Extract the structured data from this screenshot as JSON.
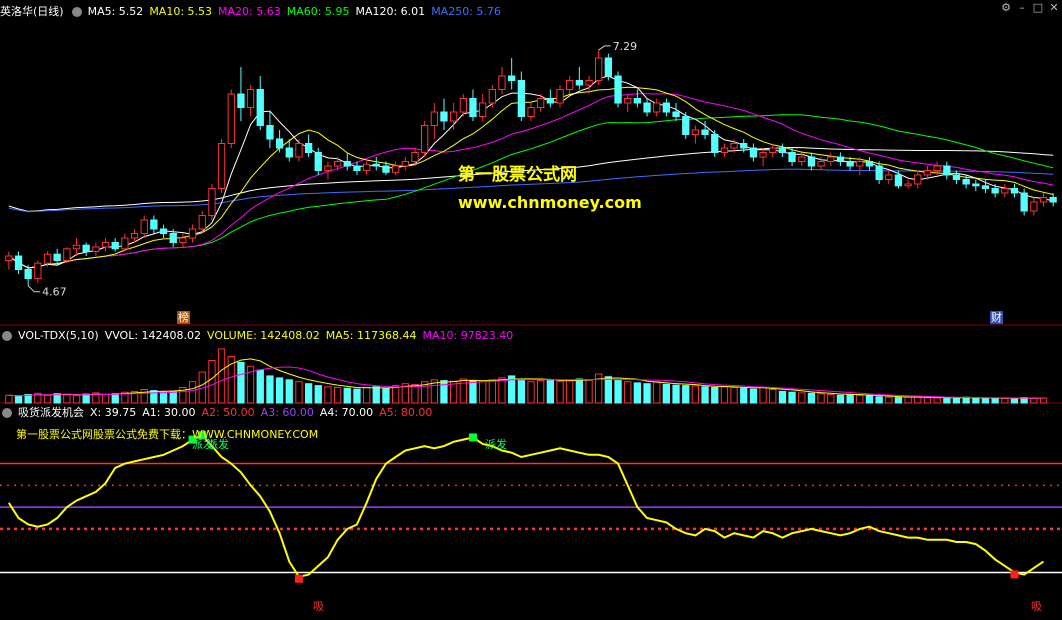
{
  "header": {
    "stock_name": "英洛华(日线)",
    "ma_items": [
      {
        "label": "MA5: 5.52",
        "color": "#ffffff"
      },
      {
        "label": "MA10: 5.53",
        "color": "#ffff00"
      },
      {
        "label": "MA20: 5.63",
        "color": "#ff00ff"
      },
      {
        "label": "MA60: 5.95",
        "color": "#00ff00"
      },
      {
        "label": "MA120: 6.01",
        "color": "#ffffff"
      },
      {
        "label": "MA250: 5.76",
        "color": "#3f6cff"
      }
    ]
  },
  "volume_header": {
    "name": "VOL-TDX(5,10)",
    "items": [
      {
        "label": "VVOL: 142408.02",
        "color": "#ffffff"
      },
      {
        "label": "VOLUME: 142408.02",
        "color": "#ffff00"
      },
      {
        "label": "MA5: 117368.44",
        "color": "#ffff00"
      },
      {
        "label": "MA10: 97823.40",
        "color": "#ff00ff"
      }
    ]
  },
  "indicator_header": {
    "name": "吸货派发机会",
    "items": [
      {
        "label": "X: 39.75",
        "color": "#ffffff"
      },
      {
        "label": "A1: 30.00",
        "color": "#ffffff"
      },
      {
        "label": "A2: 50.00",
        "color": "#ff3030"
      },
      {
        "label": "A3: 60.00",
        "color": "#9a40ff"
      },
      {
        "label": "A4: 70.00",
        "color": "#ffffff"
      },
      {
        "label": "A5: 80.00",
        "color": "#ff3030"
      }
    ]
  },
  "watermark": {
    "title": "第一股票公式网",
    "url": "www.chnmoney.com",
    "indicator_text": "第一股票公式网股票公式免费下载：WWW.CHNMONEY.COM"
  },
  "markers": {
    "bang": "榜",
    "cai": "财",
    "paifa": "派发",
    "xi": "吸"
  },
  "icons": [
    "circle-icon",
    "gear-icon",
    "minus-icon",
    "expand-icon",
    "close-icon"
  ],
  "chart_data": [
    {
      "type": "candlestick",
      "title": "英洛华(日线)",
      "price_labels": {
        "high": "7.29",
        "low": "4.67"
      },
      "ylim": [
        4.4,
        7.6
      ],
      "ma": {
        "MA5": 5.52,
        "MA10": 5.53,
        "MA20": 5.63,
        "MA60": 5.95,
        "MA120": 6.01,
        "MA250": 5.76
      },
      "series_colors": {
        "up": "#ff3030",
        "down": "#54ffff",
        "MA5": "#ffffff",
        "MA10": "#ffff00",
        "MA20": "#ff00ff",
        "MA60": "#00ff00",
        "MA120": "#ffffff",
        "MA250": "#3f6cff"
      },
      "ohlc": [
        [
          4.95,
          5.05,
          4.85,
          5.0
        ],
        [
          5.0,
          5.05,
          4.8,
          4.85
        ],
        [
          4.85,
          4.9,
          4.67,
          4.75
        ],
        [
          4.75,
          4.95,
          4.7,
          4.92
        ],
        [
          4.92,
          5.05,
          4.88,
          5.02
        ],
        [
          5.02,
          5.08,
          4.9,
          4.95
        ],
        [
          4.95,
          5.1,
          4.92,
          5.08
        ],
        [
          5.08,
          5.2,
          5.0,
          5.12
        ],
        [
          5.12,
          5.15,
          5.0,
          5.05
        ],
        [
          5.05,
          5.15,
          5.0,
          5.1
        ],
        [
          5.1,
          5.2,
          5.05,
          5.15
        ],
        [
          5.15,
          5.2,
          5.05,
          5.08
        ],
        [
          5.08,
          5.25,
          5.05,
          5.2
        ],
        [
          5.2,
          5.3,
          5.15,
          5.25
        ],
        [
          5.25,
          5.45,
          5.2,
          5.4
        ],
        [
          5.4,
          5.45,
          5.25,
          5.3
        ],
        [
          5.3,
          5.35,
          5.2,
          5.25
        ],
        [
          5.25,
          5.3,
          5.1,
          5.15
        ],
        [
          5.15,
          5.25,
          5.1,
          5.2
        ],
        [
          5.2,
          5.35,
          5.15,
          5.3
        ],
        [
          5.3,
          5.5,
          5.25,
          5.45
        ],
        [
          5.45,
          5.8,
          5.4,
          5.75
        ],
        [
          5.75,
          6.3,
          5.7,
          6.25
        ],
        [
          6.25,
          6.85,
          6.2,
          6.8
        ],
        [
          6.8,
          7.1,
          6.5,
          6.65
        ],
        [
          6.65,
          6.9,
          6.55,
          6.85
        ],
        [
          6.85,
          7.0,
          6.4,
          6.45
        ],
        [
          6.45,
          6.6,
          6.2,
          6.3
        ],
        [
          6.3,
          6.4,
          6.15,
          6.2
        ],
        [
          6.2,
          6.3,
          6.05,
          6.1
        ],
        [
          6.1,
          6.3,
          6.05,
          6.25
        ],
        [
          6.25,
          6.35,
          6.1,
          6.15
        ],
        [
          6.15,
          6.2,
          5.9,
          5.95
        ],
        [
          5.95,
          6.05,
          5.85,
          6.0
        ],
        [
          6.0,
          6.1,
          5.95,
          6.05
        ],
        [
          6.05,
          6.15,
          5.95,
          6.0
        ],
        [
          6.0,
          6.05,
          5.9,
          5.95
        ],
        [
          5.95,
          6.05,
          5.9,
          6.02
        ],
        [
          6.02,
          6.1,
          5.95,
          6.0
        ],
        [
          6.0,
          6.05,
          5.9,
          5.93
        ],
        [
          5.93,
          6.05,
          5.9,
          6.0
        ],
        [
          6.0,
          6.1,
          5.95,
          6.05
        ],
        [
          6.05,
          6.2,
          6.0,
          6.15
        ],
        [
          6.15,
          6.5,
          6.1,
          6.45
        ],
        [
          6.45,
          6.7,
          6.3,
          6.6
        ],
        [
          6.6,
          6.75,
          6.4,
          6.5
        ],
        [
          6.5,
          6.7,
          6.4,
          6.6
        ],
        [
          6.6,
          6.8,
          6.55,
          6.75
        ],
        [
          6.75,
          6.85,
          6.5,
          6.55
        ],
        [
          6.55,
          6.8,
          6.5,
          6.7
        ],
        [
          6.7,
          6.9,
          6.65,
          6.85
        ],
        [
          6.85,
          7.1,
          6.8,
          7.0
        ],
        [
          7.0,
          7.2,
          6.85,
          6.95
        ],
        [
          6.95,
          7.05,
          6.5,
          6.55
        ],
        [
          6.55,
          6.7,
          6.5,
          6.65
        ],
        [
          6.65,
          6.8,
          6.6,
          6.75
        ],
        [
          6.75,
          6.85,
          6.65,
          6.7
        ],
        [
          6.7,
          6.9,
          6.65,
          6.85
        ],
        [
          6.85,
          7.0,
          6.8,
          6.95
        ],
        [
          6.95,
          7.1,
          6.85,
          6.9
        ],
        [
          6.9,
          7.0,
          6.8,
          6.95
        ],
        [
          6.95,
          7.29,
          6.9,
          7.2
        ],
        [
          7.2,
          7.25,
          6.95,
          7.0
        ],
        [
          7.0,
          7.05,
          6.65,
          6.7
        ],
        [
          6.7,
          6.8,
          6.6,
          6.75
        ],
        [
          6.75,
          6.85,
          6.65,
          6.7
        ],
        [
          6.7,
          6.75,
          6.55,
          6.6
        ],
        [
          6.6,
          6.75,
          6.55,
          6.7
        ],
        [
          6.7,
          6.75,
          6.55,
          6.6
        ],
        [
          6.6,
          6.7,
          6.5,
          6.55
        ],
        [
          6.55,
          6.6,
          6.3,
          6.35
        ],
        [
          6.35,
          6.45,
          6.25,
          6.4
        ],
        [
          6.4,
          6.5,
          6.3,
          6.35
        ],
        [
          6.35,
          6.4,
          6.1,
          6.15
        ],
        [
          6.15,
          6.25,
          6.1,
          6.2
        ],
        [
          6.2,
          6.3,
          6.15,
          6.25
        ],
        [
          6.25,
          6.3,
          6.15,
          6.2
        ],
        [
          6.2,
          6.25,
          6.05,
          6.1
        ],
        [
          6.1,
          6.2,
          6.0,
          6.15
        ],
        [
          6.15,
          6.25,
          6.1,
          6.2
        ],
        [
          6.2,
          6.25,
          6.1,
          6.15
        ],
        [
          6.15,
          6.2,
          6.0,
          6.05
        ],
        [
          6.05,
          6.15,
          6.0,
          6.1
        ],
        [
          6.1,
          6.15,
          5.95,
          6.0
        ],
        [
          6.0,
          6.1,
          5.95,
          6.05
        ],
        [
          6.05,
          6.15,
          6.0,
          6.1
        ],
        [
          6.1,
          6.15,
          6.0,
          6.05
        ],
        [
          6.05,
          6.1,
          5.95,
          6.0
        ],
        [
          6.0,
          6.1,
          5.9,
          6.05
        ],
        [
          6.05,
          6.1,
          5.95,
          6.0
        ],
        [
          6.0,
          6.05,
          5.8,
          5.85
        ],
        [
          5.85,
          5.95,
          5.8,
          5.9
        ],
        [
          5.9,
          5.95,
          5.75,
          5.78
        ],
        [
          5.78,
          5.85,
          5.75,
          5.8
        ],
        [
          5.8,
          5.95,
          5.75,
          5.9
        ],
        [
          5.9,
          6.0,
          5.85,
          5.95
        ],
        [
          5.95,
          6.05,
          5.9,
          6.0
        ],
        [
          6.0,
          6.05,
          5.85,
          5.9
        ],
        [
          5.9,
          5.95,
          5.8,
          5.85
        ],
        [
          5.85,
          5.9,
          5.75,
          5.8
        ],
        [
          5.8,
          5.85,
          5.72,
          5.78
        ],
        [
          5.78,
          5.85,
          5.7,
          5.75
        ],
        [
          5.75,
          5.8,
          5.65,
          5.7
        ],
        [
          5.7,
          5.8,
          5.65,
          5.75
        ],
        [
          5.75,
          5.8,
          5.65,
          5.7
        ],
        [
          5.7,
          5.75,
          5.45,
          5.5
        ],
        [
          5.5,
          5.65,
          5.45,
          5.6
        ],
        [
          5.6,
          5.7,
          5.55,
          5.65
        ],
        [
          5.65,
          5.7,
          5.55,
          5.6
        ]
      ]
    },
    {
      "type": "bar",
      "title": "VOL-TDX(5,10)",
      "ylim": [
        0,
        150000
      ],
      "values": [
        20,
        18,
        22,
        25,
        20,
        24,
        21,
        19,
        23,
        26,
        22,
        24,
        28,
        30,
        35,
        32,
        28,
        30,
        40,
        55,
        80,
        110,
        140,
        120,
        105,
        95,
        85,
        70,
        65,
        60,
        55,
        50,
        45,
        42,
        40,
        38,
        36,
        40,
        42,
        38,
        45,
        50,
        48,
        55,
        60,
        58,
        56,
        62,
        58,
        55,
        60,
        65,
        70,
        62,
        55,
        58,
        60,
        56,
        58,
        62,
        60,
        75,
        68,
        58,
        55,
        52,
        50,
        55,
        48,
        46,
        45,
        44,
        42,
        40,
        42,
        40,
        38,
        36,
        40,
        35,
        30,
        28,
        26,
        25,
        24,
        22,
        20,
        22,
        20,
        18,
        16,
        15,
        14,
        15,
        16,
        14,
        13,
        12,
        14,
        15,
        13,
        12,
        11,
        12,
        13,
        14,
        12,
        13
      ]
    },
    {
      "type": "line",
      "title": "吸货派发机会",
      "ylim": [
        10,
        100
      ],
      "lines": [
        {
          "name": "A1",
          "value": 30,
          "color": "#ffffff"
        },
        {
          "name": "A2",
          "value": 50,
          "color": "#ff3030"
        },
        {
          "name": "A3",
          "value": 60,
          "color": "#9a40ff"
        },
        {
          "name": "A4",
          "value": 70,
          "color": "#ff3030"
        },
        {
          "name": "A5",
          "value": 80,
          "color": "#ff3030"
        }
      ],
      "current": {
        "X": 39.75
      },
      "values": [
        62,
        55,
        52,
        51,
        52,
        55,
        60,
        63,
        65,
        67,
        71,
        78,
        80,
        81,
        82,
        83,
        84,
        86,
        88,
        91,
        93,
        88,
        83,
        80,
        76,
        70,
        65,
        58,
        48,
        35,
        28,
        29,
        33,
        37,
        45,
        50,
        52,
        62,
        73,
        80,
        83,
        86,
        87,
        88,
        87,
        88,
        90,
        91,
        92,
        89,
        88,
        86,
        85,
        83,
        84,
        85,
        86,
        87,
        86,
        85,
        84,
        84,
        83,
        80,
        70,
        60,
        55,
        54,
        53,
        50,
        48,
        47,
        50,
        49,
        46,
        48,
        47,
        46,
        49,
        48,
        46,
        48,
        49,
        50,
        49,
        48,
        47,
        48,
        50,
        51,
        49,
        48,
        47,
        46,
        46,
        45,
        45,
        45,
        44,
        44,
        43,
        40,
        36,
        33,
        30,
        29,
        32,
        35
      ]
    }
  ]
}
